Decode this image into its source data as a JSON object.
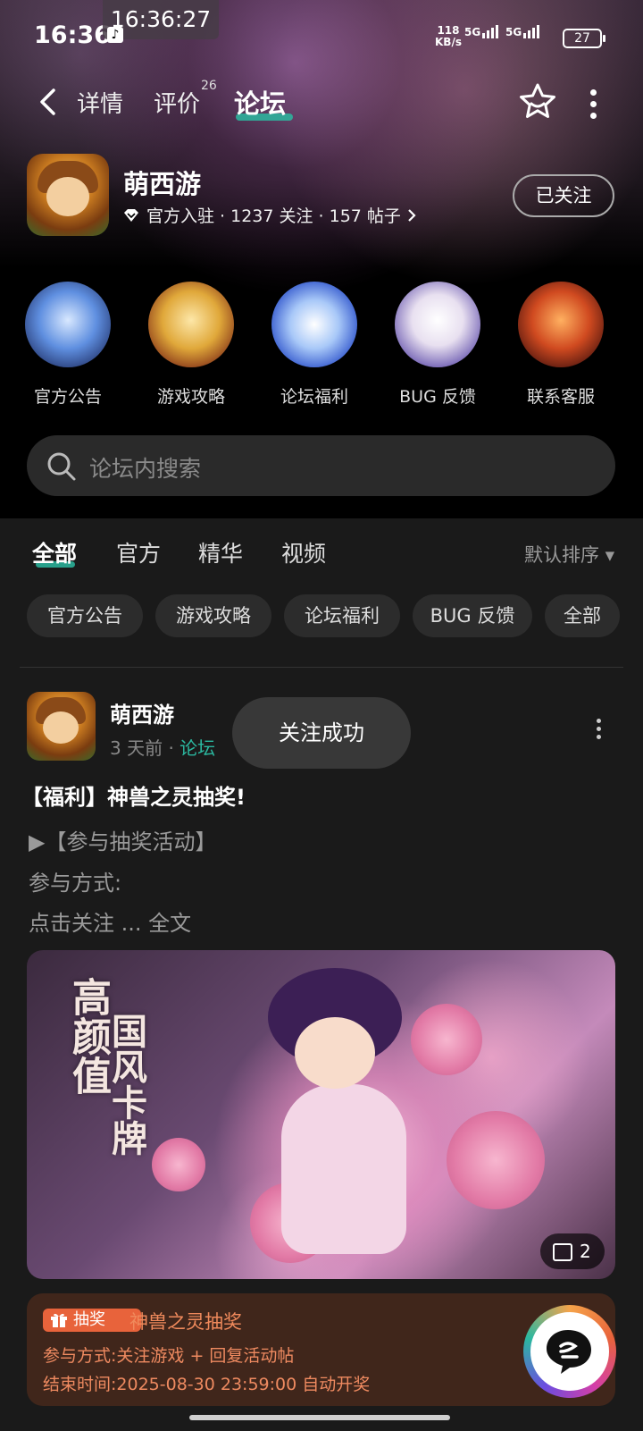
{
  "status_bar": {
    "time": "16:36",
    "clock_overlay": "16:36:27",
    "net_speed_value": "118",
    "net_speed_unit": "KB/s",
    "signal1": "5G",
    "signal2": "5G",
    "battery": "27"
  },
  "nav": {
    "tabs": [
      {
        "label": "详情"
      },
      {
        "label": "评价"
      },
      {
        "label": "论坛"
      }
    ],
    "review_count": "26",
    "active_tab": "论坛"
  },
  "app": {
    "name": "萌西游",
    "meta": "官方入驻 · 1237 关注 · 157 帖子",
    "follow_label": "已关注"
  },
  "categories": [
    {
      "label": "官方公告",
      "icon": "official-announcement-icon"
    },
    {
      "label": "游戏攻略",
      "icon": "game-guide-icon"
    },
    {
      "label": "论坛福利",
      "icon": "forum-welfare-icon"
    },
    {
      "label": "BUG 反馈",
      "icon": "bug-feedback-icon"
    },
    {
      "label": "联系客服",
      "icon": "customer-service-icon"
    }
  ],
  "search": {
    "placeholder": "论坛内搜索"
  },
  "feed_tabs": [
    {
      "label": "全部"
    },
    {
      "label": "官方"
    },
    {
      "label": "精华"
    },
    {
      "label": "视频"
    }
  ],
  "sort_label": "默认排序 ▾",
  "chips": [
    {
      "label": "官方公告"
    },
    {
      "label": "游戏攻略"
    },
    {
      "label": "论坛福利"
    },
    {
      "label": "BUG 反馈"
    },
    {
      "label": "全部"
    }
  ],
  "post": {
    "author": "萌西游",
    "time": "3 天前",
    "forum": "论坛",
    "toast": "关注成功",
    "title": "【福利】神兽之灵抽奖!",
    "line1": "▶【参与抽奖活动】",
    "line2": "参与方式:",
    "line3": "点击关注",
    "ellipsis": " ... ",
    "full_text": "全文",
    "image_text1": "高颜值",
    "image_text2": "国风卡牌",
    "image_count": "2"
  },
  "lottery": {
    "badge": "抽奖",
    "title": "神兽之灵抽奖",
    "method": "参与方式:关注游戏 + 回复活动帖",
    "end_time": "结束时间:2025-08-30 23:59:00 自动开奖"
  },
  "colors": {
    "accent": "#2bb8a0",
    "lottery_orange": "#ee8a60",
    "lottery_bg": "#40261b"
  }
}
